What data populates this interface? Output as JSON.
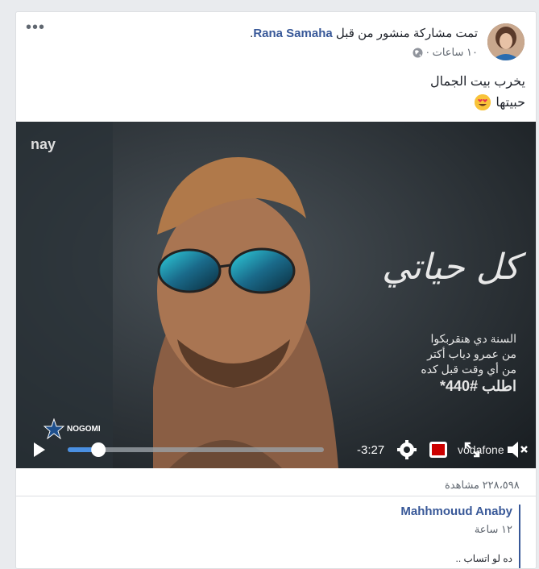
{
  "post": {
    "share_prefix": "تمت مشاركة منشور من قبل",
    "author": "Rana Samaha",
    "author_suffix": ".",
    "time": "١٠ ساعات ·",
    "line1": "يخرب بيت الجمال",
    "line2": "حبيتها",
    "more_icon": "•••"
  },
  "video": {
    "logo_top": "nay",
    "title_art": "كل حياتي",
    "ad_line1": "السنة دي هنقربكوا",
    "ad_line2": "من عمرو دياب أكتر",
    "ad_line3": "من أي وقت قبل كده",
    "ad_line4": "اطلب #440*",
    "brand_left": "NOGOMI",
    "brand_right": "vodafone",
    "time_remaining": "-3:27",
    "progress_fraction": 0.12
  },
  "stats": {
    "views": "٢٢٨،٥٩٨ مشاهدة"
  },
  "comment": {
    "name": "Mahhmouud Anaby",
    "time": "١٢ ساعة",
    "text": "ده لو اتساب .."
  }
}
